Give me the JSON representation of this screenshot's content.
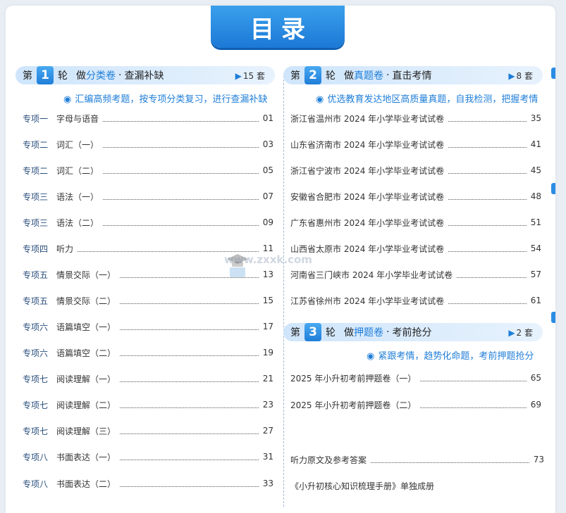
{
  "header": {
    "title": "目录"
  },
  "left_round": {
    "prefix": "第",
    "number": "1",
    "suffix": "轮",
    "do": "做",
    "highlight": "分类卷",
    "sep": "·",
    "tail": "查漏补缺",
    "count_icon": "play-triangle-icon",
    "count": "15 套",
    "subtitle_icon": "target-bullet-icon",
    "subtitle": "汇编高频考题，按专项分类复习，进行查漏补缺",
    "items": [
      {
        "label": "专项一",
        "name": "字母与语音",
        "page": "01"
      },
      {
        "label": "专项二",
        "name": "词汇（一）",
        "page": "03"
      },
      {
        "label": "专项二",
        "name": "词汇（二）",
        "page": "05"
      },
      {
        "label": "专项三",
        "name": "语法（一）",
        "page": "07"
      },
      {
        "label": "专项三",
        "name": "语法（二）",
        "page": "09"
      },
      {
        "label": "专项四",
        "name": "听力",
        "page": "11"
      },
      {
        "label": "专项五",
        "name": "情景交际（一）",
        "page": "13"
      },
      {
        "label": "专项五",
        "name": "情景交际（二）",
        "page": "15"
      },
      {
        "label": "专项六",
        "name": "语篇填空（一）",
        "page": "17"
      },
      {
        "label": "专项六",
        "name": "语篇填空（二）",
        "page": "19"
      },
      {
        "label": "专项七",
        "name": "阅读理解（一）",
        "page": "21"
      },
      {
        "label": "专项七",
        "name": "阅读理解（二）",
        "page": "23"
      },
      {
        "label": "专项七",
        "name": "阅读理解（三）",
        "page": "27"
      },
      {
        "label": "专项八",
        "name": "书面表达（一）",
        "page": "31"
      },
      {
        "label": "专项八",
        "name": "书面表达（二）",
        "page": "33"
      }
    ]
  },
  "right_round_2": {
    "prefix": "第",
    "number": "2",
    "suffix": "轮",
    "do": "做",
    "highlight": "真题卷",
    "sep": "·",
    "tail": "直击考情",
    "count": "8 套",
    "subtitle": "优选教育发达地区高质量真题，自我检测，把握考情",
    "items": [
      {
        "name": "浙江省温州市 2024 年小学毕业考试试卷",
        "page": "35"
      },
      {
        "name": "山东省济南市 2024 年小学毕业考试试卷",
        "page": "41"
      },
      {
        "name": "浙江省宁波市 2024 年小学毕业考试试卷",
        "page": "45"
      },
      {
        "name": "安徽省合肥市 2024 年小学毕业考试试卷",
        "page": "48"
      },
      {
        "name": "广东省惠州市 2024 年小学毕业考试试卷",
        "page": "51"
      },
      {
        "name": "山西省太原市 2024 年小学毕业考试试卷",
        "page": "54"
      },
      {
        "name": "河南省三门峡市 2024 年小学毕业考试试卷",
        "page": "57"
      },
      {
        "name": "江苏省徐州市 2024 年小学毕业考试试卷",
        "page": "61"
      }
    ]
  },
  "right_round_3": {
    "prefix": "第",
    "number": "3",
    "suffix": "轮",
    "do": "做",
    "highlight": "押题卷",
    "sep": "·",
    "tail": "考前抢分",
    "count": "2 套",
    "subtitle": "紧跟考情，趋势化命题，考前押题抢分",
    "items": [
      {
        "name": "2025 年小升初考前押题卷（一）",
        "page": "65"
      },
      {
        "name": "2025 年小升初考前押题卷（二）",
        "page": "69"
      }
    ]
  },
  "appendix": {
    "name": "听力原文及参考答案",
    "page": "73"
  },
  "footnote": "《小升初核心知识梳理手册》单独成册",
  "watermark": "www.zxxk.com",
  "colors": {
    "accent": "#1f7ed8",
    "bar": "#cfe5fb"
  }
}
